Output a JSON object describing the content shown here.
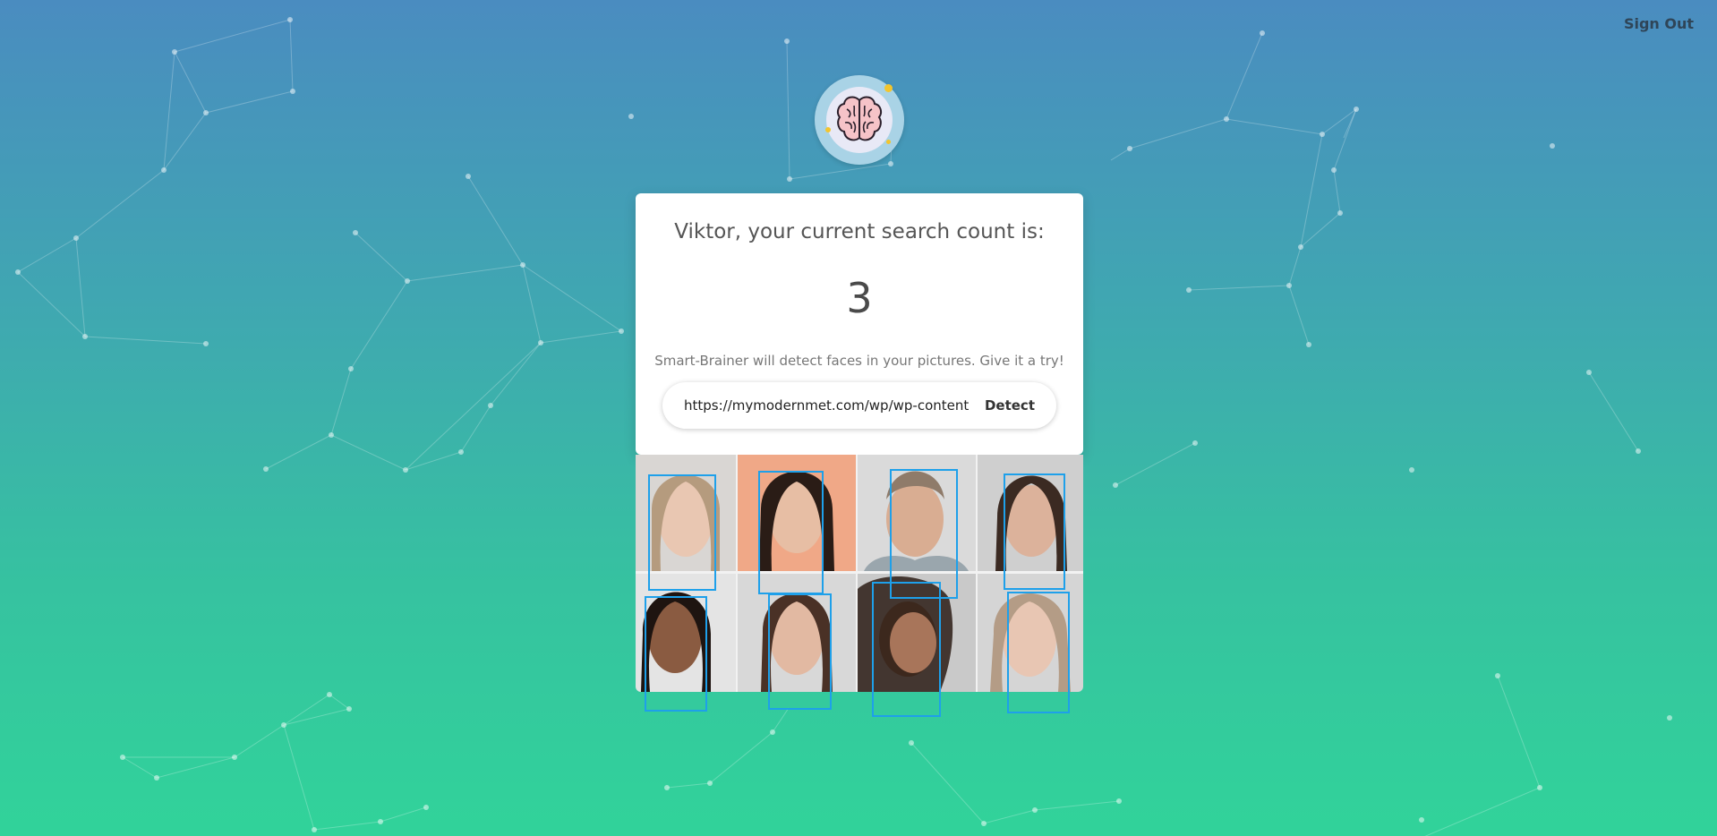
{
  "header": {
    "signout_label": "Sign Out"
  },
  "logo": {
    "icon": "brain-icon"
  },
  "card": {
    "greeting": "Viktor, your current search count is:",
    "count": "3",
    "tagline": "Smart-Brainer will detect faces in your pictures. Give it a try!"
  },
  "search": {
    "url_value": "https://mymodernmet.com/wp/wp-content",
    "detect_label": "Detect"
  },
  "result": {
    "faces_detected": 8
  },
  "colors": {
    "bbox": "#1ea0ea",
    "card": "#ffffff",
    "bg_top": "#4a8cc0",
    "bg_bottom": "#31d39a"
  }
}
